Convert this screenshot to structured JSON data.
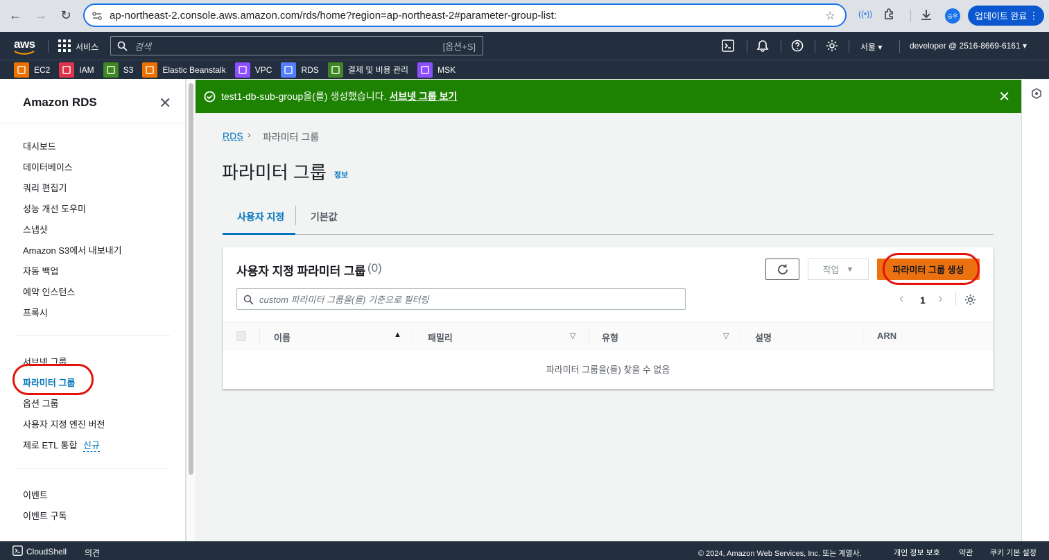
{
  "browser": {
    "url": "ap-northeast-2.console.aws.amazon.com/rds/home?region=ap-northeast-2#parameter-group-list:",
    "profile_initials": "승우",
    "update_label": "업데이트 완료"
  },
  "aws_header": {
    "logo": "aws",
    "services_label": "서비스",
    "search_placeholder": "검색",
    "search_shortcut": "[옵션+S]",
    "region": "서울",
    "account": "developer @ 2516-8669-6161"
  },
  "favorites": [
    {
      "label": "EC2",
      "icon": "ec2-icon",
      "color": "#ed7100"
    },
    {
      "label": "IAM",
      "icon": "iam-icon",
      "color": "#dd344c"
    },
    {
      "label": "S3",
      "icon": "s3-icon",
      "color": "#3f8624"
    },
    {
      "label": "Elastic Beanstalk",
      "icon": "beanstalk-icon",
      "color": "#ed7100"
    },
    {
      "label": "VPC",
      "icon": "vpc-icon",
      "color": "#8c4fff"
    },
    {
      "label": "RDS",
      "icon": "rds-icon",
      "color": "#527fff"
    },
    {
      "label": "결제 및 비용 관리",
      "icon": "billing-icon",
      "color": "#3f8624"
    },
    {
      "label": "MSK",
      "icon": "msk-icon",
      "color": "#8c4fff"
    }
  ],
  "sidebar": {
    "title": "Amazon RDS",
    "group1": [
      "대시보드",
      "데이터베이스",
      "쿼리 편집기",
      "성능 개선 도우미",
      "스냅샷",
      "Amazon S3에서 내보내기",
      "자동 백업",
      "예약 인스턴스",
      "프록시"
    ],
    "group2": [
      "서브넷 그룹",
      "파라미터 그룹",
      "옵션 그룹",
      "사용자 지정 엔진 버전",
      "제로 ETL 통합"
    ],
    "new_badge": "신규",
    "group3": [
      "이벤트",
      "이벤트 구독"
    ]
  },
  "flash": {
    "message": "test1-db-sub-group을(를) 생성했습니다.",
    "link": "서브넷 그룹 보기"
  },
  "breadcrumb": {
    "root": "RDS",
    "current": "파라미터 그룹"
  },
  "page": {
    "title": "파라미터 그룹",
    "info": "정보"
  },
  "tabs": {
    "custom": "사용자 지정",
    "default": "기본값"
  },
  "panel": {
    "title": "사용자 지정 파라미터 그룹",
    "count": "(0)",
    "actions_label": "작업",
    "create_label": "파라미터 그룹 생성",
    "filter_placeholder": "custom 파라미터 그룹을(를) 기준으로 필터링",
    "page_number": "1",
    "columns": [
      "이름",
      "패밀리",
      "유형",
      "설명",
      "ARN"
    ],
    "empty": "파라미터 그룹을(를) 찾을 수 없음"
  },
  "footer": {
    "cloudshell": "CloudShell",
    "feedback": "의견",
    "copyright": "© 2024, Amazon Web Services, Inc. 또는 계열사.",
    "privacy": "개인 정보 보호",
    "terms": "약관",
    "cookies": "쿠키 기본 설정"
  }
}
